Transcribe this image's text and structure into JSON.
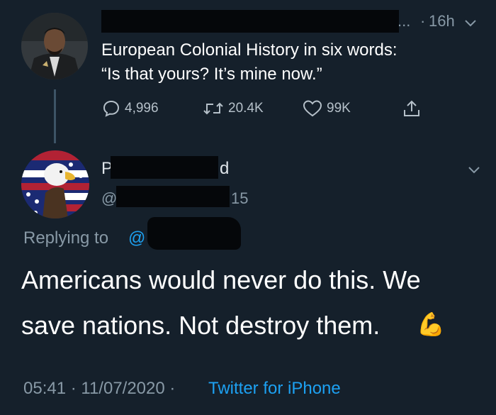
{
  "parent_tweet": {
    "time": "16h",
    "separator": "·",
    "ellipsis": "...",
    "text_line1": "European Colonial History in six words:",
    "text_line2": "“Is that yours? It’s mine now.”",
    "actions": {
      "replies": "4,996",
      "retweets": "20.4K",
      "likes": "99K"
    },
    "icons": {
      "menu": "chevron-down-icon",
      "reply": "reply-icon",
      "retweet": "retweet-icon",
      "like": "heart-icon",
      "share": "share-icon"
    }
  },
  "reply_tweet": {
    "name_initial": "P",
    "name_end": "d",
    "handle_prefix": "@",
    "handle_suffix": "15",
    "replying_label": "Replying to",
    "replying_handle": "@",
    "text_line1": "Americans would never do this. We",
    "text_line2": "save nations. Not destroy them.",
    "emoji": "💪",
    "timestamp": "05:41 · 11/07/2020 ·",
    "source": "Twitter for iPhone"
  },
  "colors": {
    "background": "#15202b",
    "text": "#ffffff",
    "muted": "#8899a6",
    "link": "#1da1f2"
  }
}
